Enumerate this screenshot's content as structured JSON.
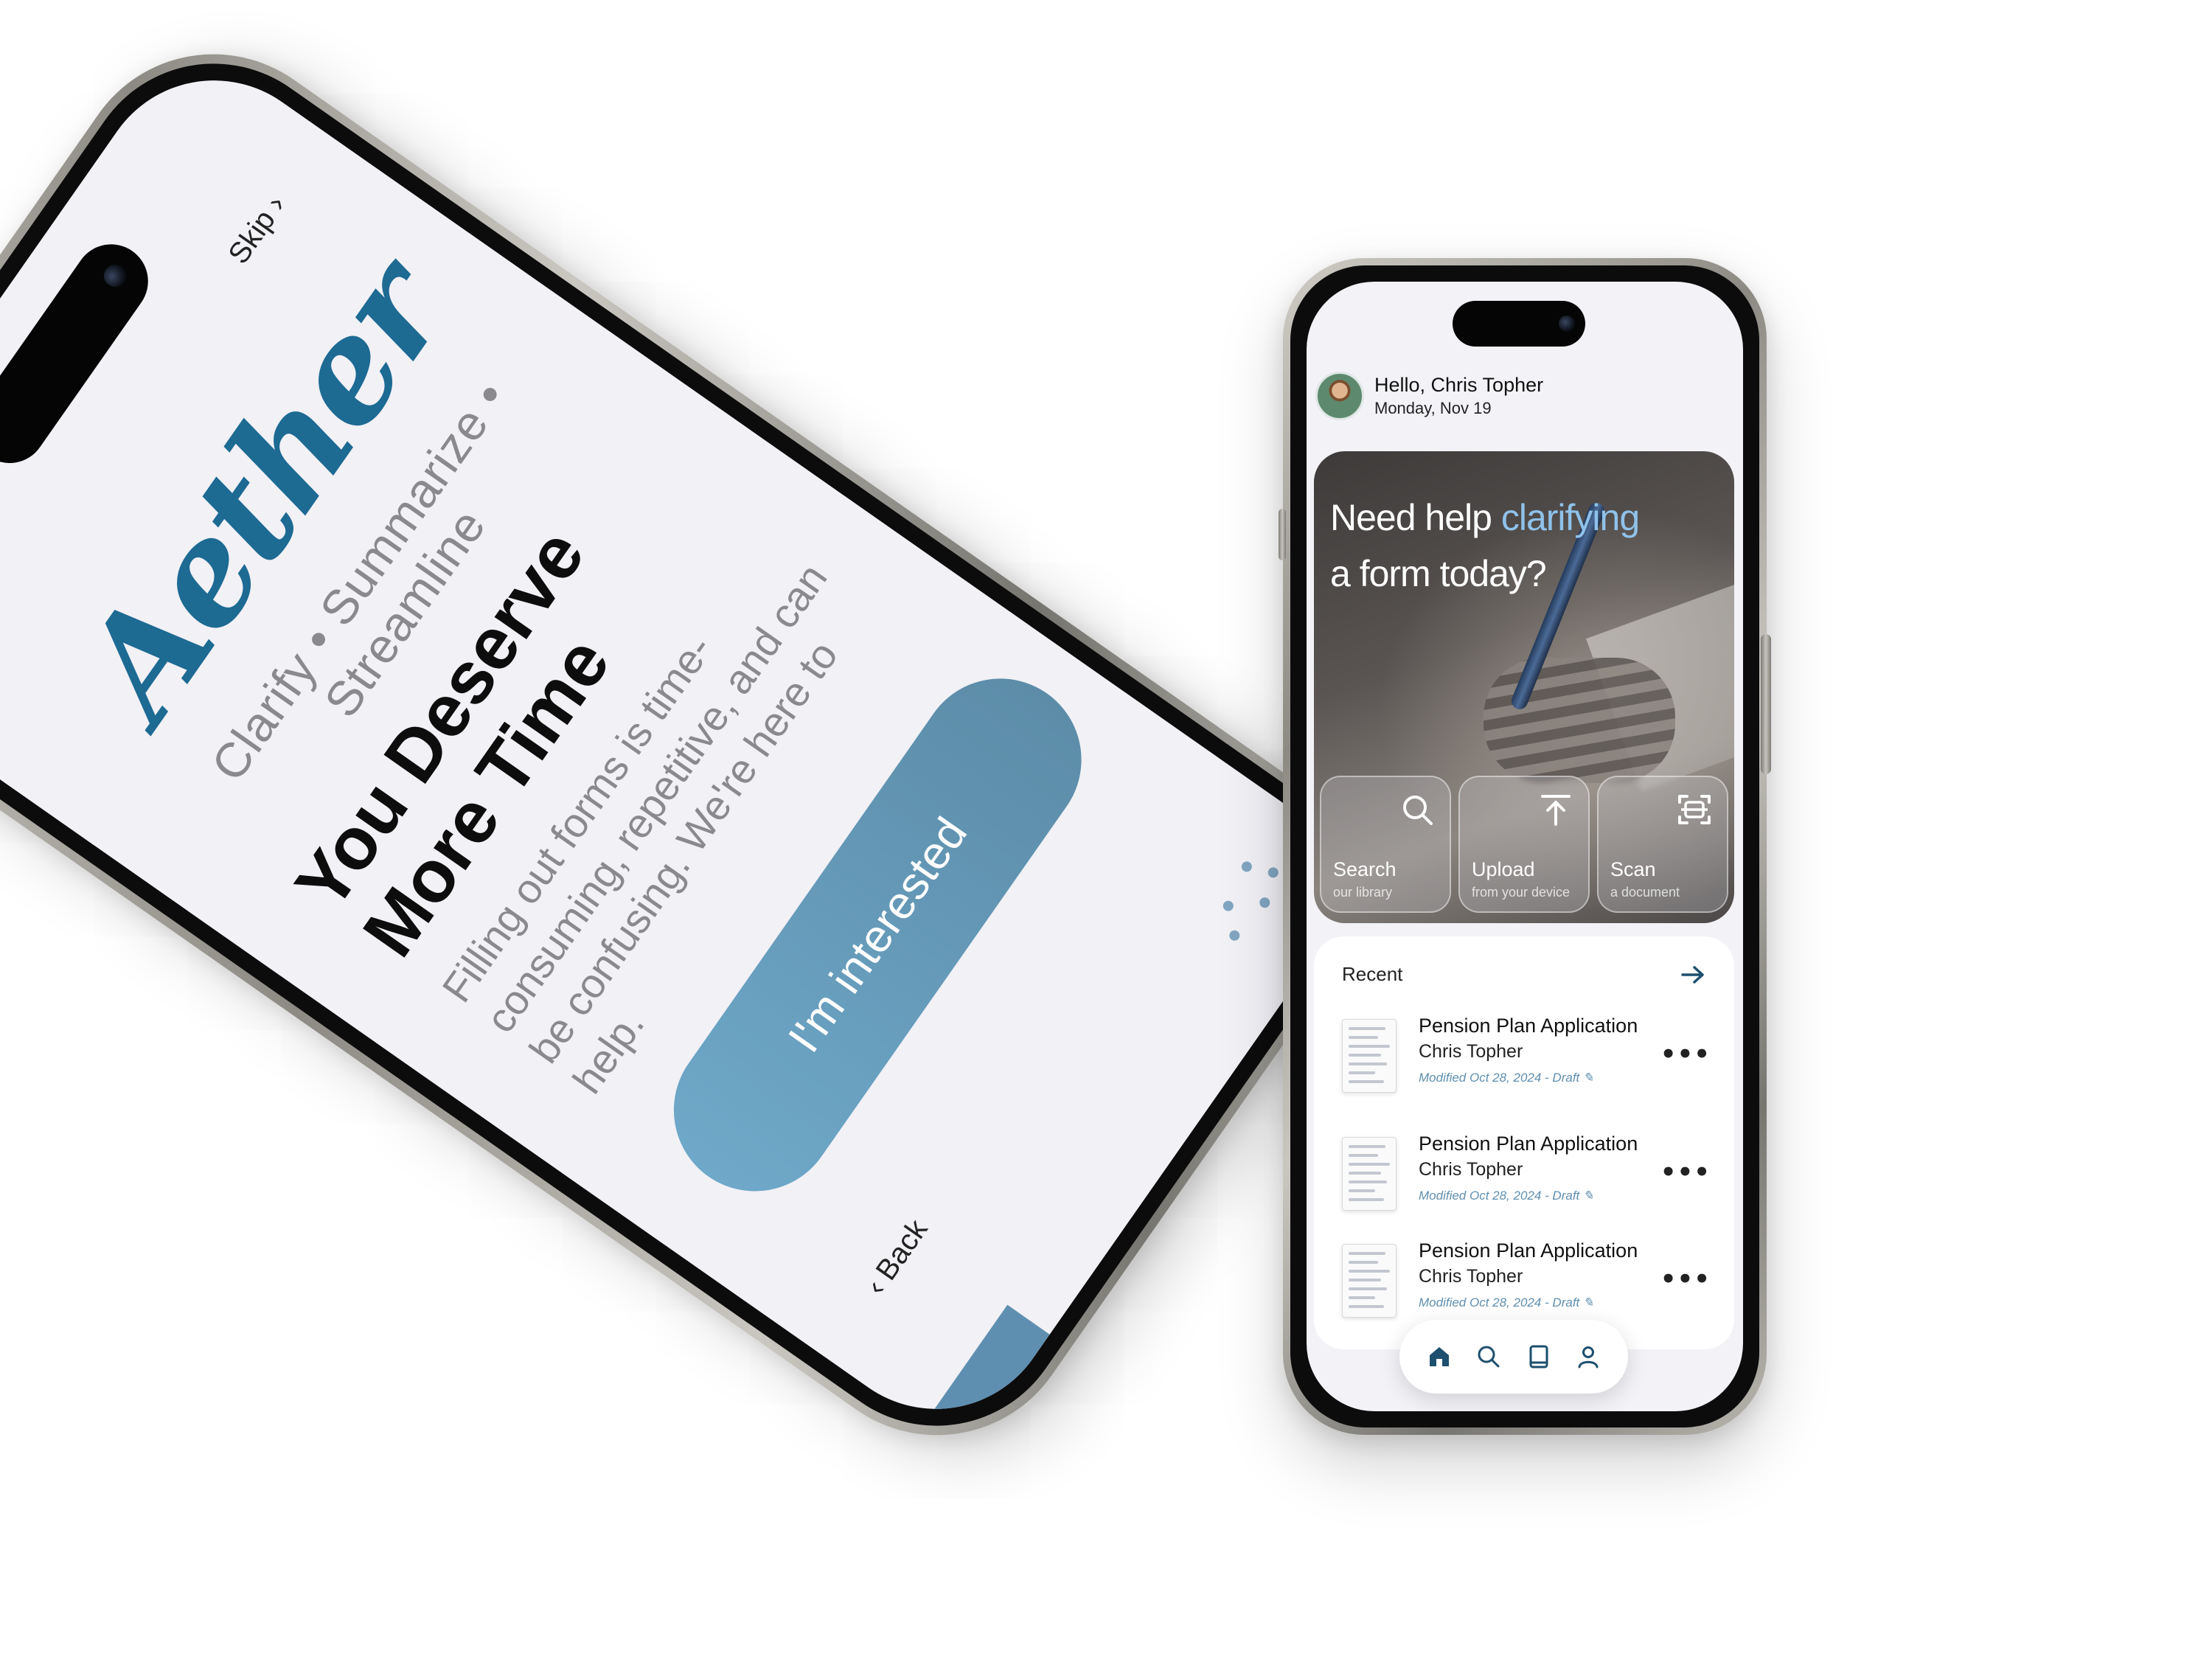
{
  "onboarding": {
    "brand": "Aether",
    "tagline": "Clarify • Summarize • Streamline",
    "skip_label": "Skip ›",
    "headline_line1": "You Deserve",
    "headline_line2": "More Time",
    "body": "Filling out forms is time-consuming, repetitive, and can be confusing. We're here to help.",
    "cta_label": "I'm interested",
    "back_label": "‹ Back"
  },
  "home": {
    "greeting": "Hello, Chris Topher",
    "date": "Monday, Nov 19",
    "hero_prefix": "Need help ",
    "hero_highlight": "clarifying",
    "hero_suffix": "a form today?",
    "actions": [
      {
        "title": "Search",
        "subtitle": "our library",
        "icon": "search-icon"
      },
      {
        "title": "Upload",
        "subtitle": "from your device",
        "icon": "upload-icon"
      },
      {
        "title": "Scan",
        "subtitle": "a document",
        "icon": "scan-icon"
      }
    ],
    "recent_title": "Recent",
    "recent": [
      {
        "title": "Pension Plan Application",
        "owner": "Chris Topher",
        "meta": "Modified Oct 28, 2024 - Draft ✎"
      },
      {
        "title": "Pension Plan Application",
        "owner": "Chris Topher",
        "meta": "Modified Oct 28, 2024 - Draft ✎"
      },
      {
        "title": "Pension Plan Application",
        "owner": "Chris Topher",
        "meta": "Modified Oct 28, 2024 - Draft ✎"
      }
    ],
    "more_label": "•••",
    "tabs": [
      "home-icon",
      "search-icon",
      "book-icon",
      "profile-icon"
    ]
  },
  "colors": {
    "brand_blue": "#1d6a93",
    "accent_light": "#8fc2ea",
    "cta_start": "#6fa8c9",
    "cta_end": "#5c8ca8"
  }
}
